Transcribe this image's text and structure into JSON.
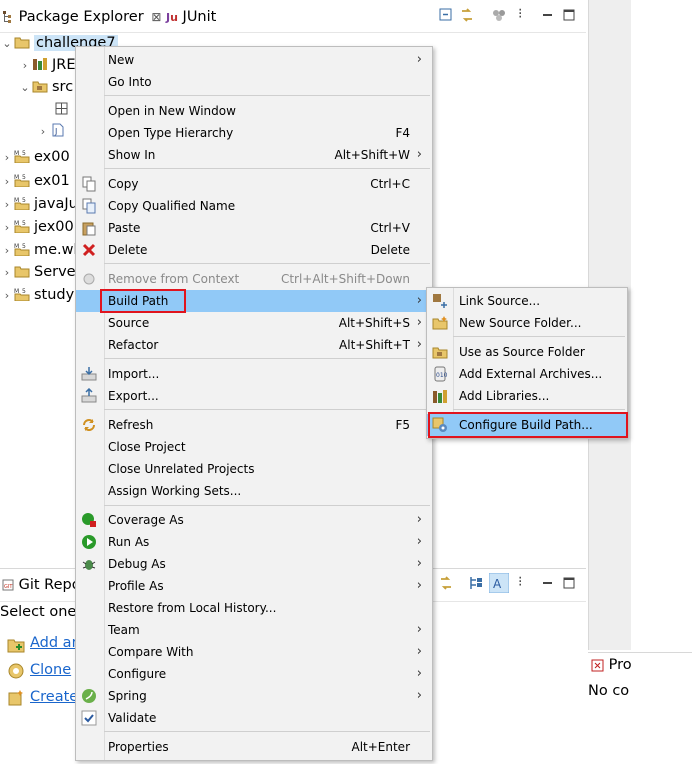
{
  "package_explorer": {
    "tab_label": "Package Explorer",
    "tab_close": "⊠",
    "junit_label": "JUnit",
    "tree": [
      {
        "label": "challenge7",
        "indent": 0,
        "expanded": true,
        "selected": true
      },
      {
        "label": "JRE",
        "indent": 1,
        "expanded": false
      },
      {
        "label": "src",
        "indent": 1,
        "expanded": true
      },
      {
        "label": "",
        "indent": 2,
        "expanded": null
      },
      {
        "label": "",
        "indent": 2,
        "expanded": false
      },
      {
        "label": "ex00",
        "indent": 0,
        "expanded": false
      },
      {
        "label": "ex01",
        "indent": 0,
        "expanded": false
      },
      {
        "label": "javaJu",
        "indent": 0,
        "expanded": false
      },
      {
        "label": "jex00",
        "indent": 0,
        "expanded": false
      },
      {
        "label": "me.wh",
        "indent": 0,
        "expanded": false
      },
      {
        "label": "Serve",
        "indent": 0,
        "expanded": false
      },
      {
        "label": "study",
        "indent": 0,
        "expanded": false
      }
    ]
  },
  "git_view": {
    "tab_label": "Git Repo",
    "message": "Select one",
    "links": [
      "Add an",
      "Clone",
      "Create"
    ]
  },
  "right_view": {
    "tab_label": "Pro",
    "message": "No co"
  },
  "context_menu": {
    "items": [
      {
        "label": "New",
        "accel": "",
        "submenu": true
      },
      {
        "label": "Go Into",
        "accel": "",
        "submenu": false
      },
      {
        "label": "Open in New Window",
        "accel": "",
        "submenu": false
      },
      {
        "label": "Open Type Hierarchy",
        "accel": "F4",
        "submenu": false
      },
      {
        "label": "Show In",
        "accel": "Alt+Shift+W",
        "submenu": true
      },
      {
        "label": "Copy",
        "accel": "Ctrl+C",
        "submenu": false
      },
      {
        "label": "Copy Qualified Name",
        "accel": "",
        "submenu": false
      },
      {
        "label": "Paste",
        "accel": "Ctrl+V",
        "submenu": false
      },
      {
        "label": "Delete",
        "accel": "Delete",
        "submenu": false
      },
      {
        "label": "Remove from Context",
        "accel": "Ctrl+Alt+Shift+Down",
        "submenu": false,
        "disabled": true
      },
      {
        "label": "Build Path",
        "accel": "",
        "submenu": true,
        "selected": true
      },
      {
        "label": "Source",
        "accel": "Alt+Shift+S",
        "submenu": true
      },
      {
        "label": "Refactor",
        "accel": "Alt+Shift+T",
        "submenu": true
      },
      {
        "label": "Import...",
        "accel": "",
        "submenu": false
      },
      {
        "label": "Export...",
        "accel": "",
        "submenu": false
      },
      {
        "label": "Refresh",
        "accel": "F5",
        "submenu": false
      },
      {
        "label": "Close Project",
        "accel": "",
        "submenu": false
      },
      {
        "label": "Close Unrelated Projects",
        "accel": "",
        "submenu": false
      },
      {
        "label": "Assign Working Sets...",
        "accel": "",
        "submenu": false
      },
      {
        "label": "Coverage As",
        "accel": "",
        "submenu": true
      },
      {
        "label": "Run As",
        "accel": "",
        "submenu": true
      },
      {
        "label": "Debug As",
        "accel": "",
        "submenu": true
      },
      {
        "label": "Profile As",
        "accel": "",
        "submenu": true
      },
      {
        "label": "Restore from Local History...",
        "accel": "",
        "submenu": false
      },
      {
        "label": "Team",
        "accel": "",
        "submenu": true
      },
      {
        "label": "Compare With",
        "accel": "",
        "submenu": true
      },
      {
        "label": "Configure",
        "accel": "",
        "submenu": true
      },
      {
        "label": "Spring",
        "accel": "",
        "submenu": true
      },
      {
        "label": "Validate",
        "accel": "",
        "submenu": false,
        "checked": true
      },
      {
        "label": "Properties",
        "accel": "Alt+Enter",
        "submenu": false
      }
    ]
  },
  "build_path_submenu": {
    "items": [
      {
        "label": "Link Source..."
      },
      {
        "label": "New Source Folder..."
      },
      {
        "label": "Use as Source Folder"
      },
      {
        "label": "Add External Archives..."
      },
      {
        "label": "Add Libraries..."
      },
      {
        "label": "Configure Build Path...",
        "selected": true
      }
    ]
  },
  "colors": {
    "selection": "#91c9f7",
    "highlight_box": "#e0141e",
    "menu_bg": "#f2f2f2",
    "link": "#1a66cc"
  }
}
